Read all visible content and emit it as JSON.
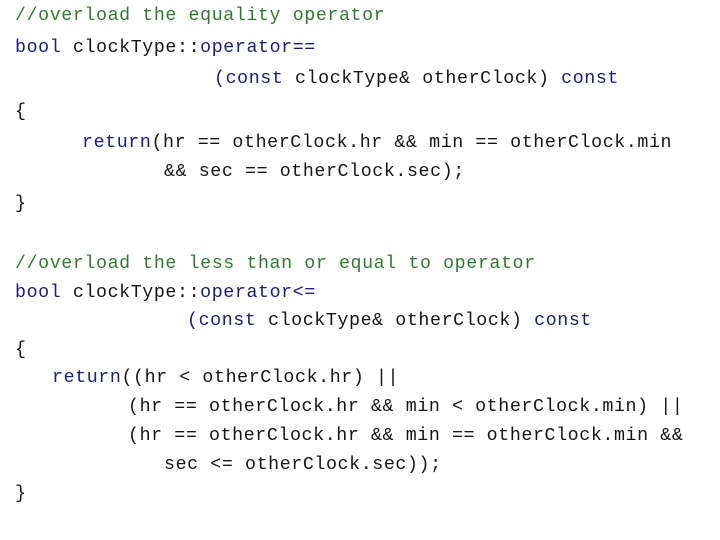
{
  "colors": {
    "comment": "#2f7a32",
    "keyword": "#1b1b7a",
    "text": "#151515",
    "background": "#ffffff"
  },
  "lines": [
    {
      "segments": [
        {
          "t": "//overload the equality operator",
          "c": "cm"
        }
      ]
    },
    {
      "segments": [
        {
          "t": "bool",
          "c": "kw"
        },
        {
          "t": " clockType::",
          "c": "tx"
        },
        {
          "t": "operator==",
          "c": "kw"
        }
      ]
    },
    {
      "segments": [
        {
          "t": "(const",
          "c": "kw"
        },
        {
          "t": " clockType& otherClock) ",
          "c": "tx"
        },
        {
          "t": "const",
          "c": "kw"
        }
      ]
    },
    {
      "segments": [
        {
          "t": "{",
          "c": "tx"
        }
      ]
    },
    {
      "segments": [
        {
          "t": "return",
          "c": "kw"
        },
        {
          "t": "(hr == otherClock.hr && min == otherClock.min",
          "c": "tx"
        }
      ]
    },
    {
      "segments": [
        {
          "t": "&& sec == otherClock.sec);",
          "c": "tx"
        }
      ]
    },
    {
      "segments": [
        {
          "t": "}",
          "c": "tx"
        }
      ]
    },
    {
      "segments": [
        {
          "t": "//overload the less than or equal to operator",
          "c": "cm"
        }
      ]
    },
    {
      "segments": [
        {
          "t": "bool",
          "c": "kw"
        },
        {
          "t": " clockType::",
          "c": "tx"
        },
        {
          "t": "operator<=",
          "c": "kw"
        }
      ]
    },
    {
      "segments": [
        {
          "t": "(const",
          "c": "kw"
        },
        {
          "t": " clockType& otherClock) ",
          "c": "tx"
        },
        {
          "t": "const",
          "c": "kw"
        }
      ]
    },
    {
      "segments": [
        {
          "t": "{",
          "c": "tx"
        }
      ]
    },
    {
      "segments": [
        {
          "t": "return",
          "c": "kw"
        },
        {
          "t": "((hr < otherClock.hr) ||",
          "c": "tx"
        }
      ]
    },
    {
      "segments": [
        {
          "t": "(hr == otherClock.hr && min < otherClock.min) ||",
          "c": "tx"
        }
      ]
    },
    {
      "segments": [
        {
          "t": "(hr == otherClock.hr && min == otherClock.min &&",
          "c": "tx"
        }
      ]
    },
    {
      "segments": [
        {
          "t": "sec <= otherClock.sec));",
          "c": "tx"
        }
      ]
    },
    {
      "segments": [
        {
          "t": "}",
          "c": "tx"
        }
      ]
    }
  ]
}
